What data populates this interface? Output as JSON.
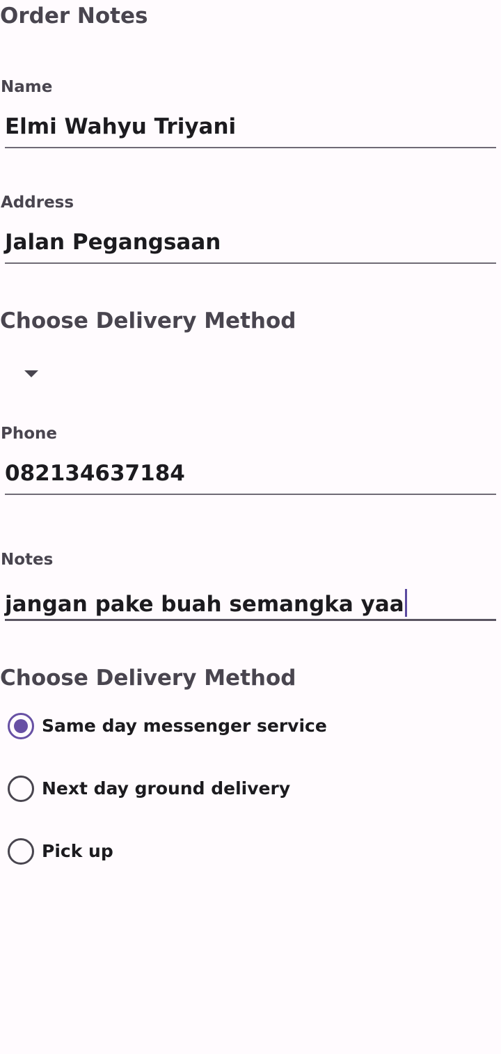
{
  "page": {
    "title": "Order Notes"
  },
  "form": {
    "name": {
      "label": "Name",
      "value": "Elmi Wahyu Triyani"
    },
    "address": {
      "label": "Address",
      "value": "Jalan Pegangsaan"
    },
    "delivery_spinner": {
      "title": "Choose Delivery Method",
      "selected": ""
    },
    "phone": {
      "label": "Phone",
      "value": "082134637184"
    },
    "notes": {
      "label": "Notes",
      "value": "jangan pake buah semangka yaa"
    }
  },
  "delivery_radio": {
    "title": "Choose Delivery Method",
    "options": [
      {
        "label": "Same day messenger service",
        "checked": true
      },
      {
        "label": "Next day ground delivery",
        "checked": false
      },
      {
        "label": "Pick up",
        "checked": false
      }
    ]
  },
  "colors": {
    "background": "#fffbfe",
    "accent": "#6750a4",
    "label": "#49454f",
    "text": "#1c1b1f"
  }
}
